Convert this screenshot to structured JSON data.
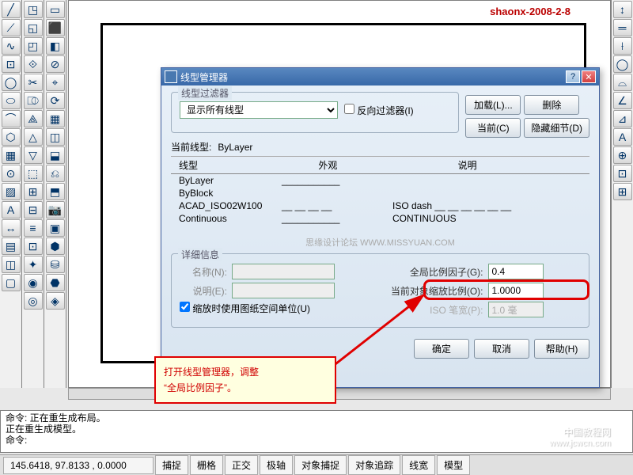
{
  "watermark": "shaonx-2008-2-8",
  "dialog": {
    "title": "线型管理器",
    "filter_group": "线型过滤器",
    "filter_select": "显示所有线型",
    "reverse_filter": "反向过滤器(I)",
    "btn_load": "加载(L)...",
    "btn_delete": "删除",
    "btn_current": "当前(C)",
    "btn_hide": "隐藏细节(D)",
    "current_linetype_label": "当前线型:",
    "current_linetype_value": "ByLayer",
    "col_linetype": "线型",
    "col_appearance": "外观",
    "col_desc": "说明",
    "rows": [
      {
        "name": "ByLayer",
        "app": "___________",
        "desc": ""
      },
      {
        "name": "ByBlock",
        "app": "",
        "desc": ""
      },
      {
        "name": "ACAD_ISO02W100",
        "app": "__ __ __ __",
        "desc": "ISO dash __ __ __ __ __ __"
      },
      {
        "name": "Continuous",
        "app": "___________",
        "desc": "CONTINUOUS"
      }
    ],
    "forum_text": "思缘设计论坛  WWW.MISSYUAN.COM",
    "detail_group": "详细信息",
    "lbl_name": "名称(N):",
    "lbl_desc": "说明(E):",
    "lbl_global": "全局比例因子(G):",
    "val_global": "0.4",
    "lbl_obj_scale": "当前对象缩放比例(O):",
    "val_obj_scale": "1.0000",
    "lbl_iso_pen": "ISO 笔宽(P):",
    "val_iso_pen": "1.0 毫",
    "chk_paper": "缩放时使用图纸空间单位(U)",
    "btn_ok": "确定",
    "btn_cancel": "取消",
    "btn_help": "帮助(H)"
  },
  "cmd": {
    "line1": "命令:  正在重生成布局。",
    "line2": "正在重生成模型。",
    "line3": "命令:"
  },
  "status": {
    "coords": "145.6418, 97.8133 , 0.0000",
    "items": [
      "捕捉",
      "栅格",
      "正交",
      "极轴",
      "对象捕捉",
      "对象追踪",
      "线宽",
      "模型"
    ]
  },
  "annotation": {
    "callout_l1": "打开线型管理器，调整",
    "callout_l2": "“全局比例因子”。"
  },
  "watermark2": {
    "l1": "中国教程网",
    "l2": "www.jcwcn.com"
  }
}
